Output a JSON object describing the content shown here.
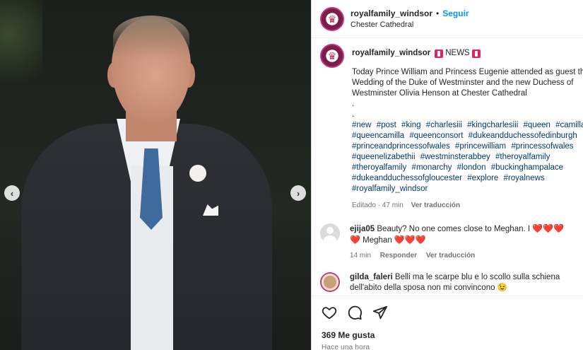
{
  "post": {
    "username": "royalfamily_windsor",
    "follow_label": "Seguir",
    "location": "Chester Cathedral",
    "caption_tag": "NEWS",
    "caption_text": "Today Prince William and Princess Eugenie attended as guest the Wedding of the Duke of Westminster and the new Duchess of Westminster Olivia Henson at Chester Cathedral\n.\n.",
    "hashtags": [
      "#new",
      "#post",
      "#king",
      "#charlesiii",
      "#kingcharlesiii",
      "#queen",
      "#camilla",
      "#queencamilla",
      "#queenconsort",
      "#dukeandduchessofedinburgh",
      "#princeandprincessofwales",
      "#princewilliam",
      "#princessofwales",
      "#queenelizabethii",
      "#westminsterabbey",
      "#theroyalfamily",
      "#theroyalfamily",
      "#monarchy",
      "#london",
      "#buckinghampalace",
      "#dukeandduchessofgloucester",
      "#explore",
      "#royalnews",
      "#royalfamily_windsor"
    ],
    "caption_meta_time": "Editado · 47 min",
    "caption_translate": "Ver traducción",
    "likes": "369 Me gusta",
    "posted": "Hace una hora"
  },
  "comments": [
    {
      "user": "ejija05",
      "text_a": "Beauty? No one comes close to Meghan. I",
      "hearts_a": "❤️❤️❤️",
      "hearts_b": "❤️",
      "text_b": "Meghan",
      "hearts_c": "❤️❤️❤️",
      "time": "14 min",
      "reply": "Responder",
      "translate": "Ver traducción"
    },
    {
      "user": "gilda_faleri",
      "text": "Belli ma le scarpe blu e lo scollo sulla schiena dell'abito della sposa non mi convincono",
      "emoji": "😉"
    }
  ],
  "icons": {
    "like": "heart-icon",
    "comment": "comment-icon",
    "share": "share-icon",
    "prev": "chevron-left-icon",
    "next": "chevron-right-icon"
  },
  "colors": {
    "link": "#0095f6",
    "hashtag": "#00376b",
    "muted": "#737373",
    "heart": "#e0245e"
  }
}
